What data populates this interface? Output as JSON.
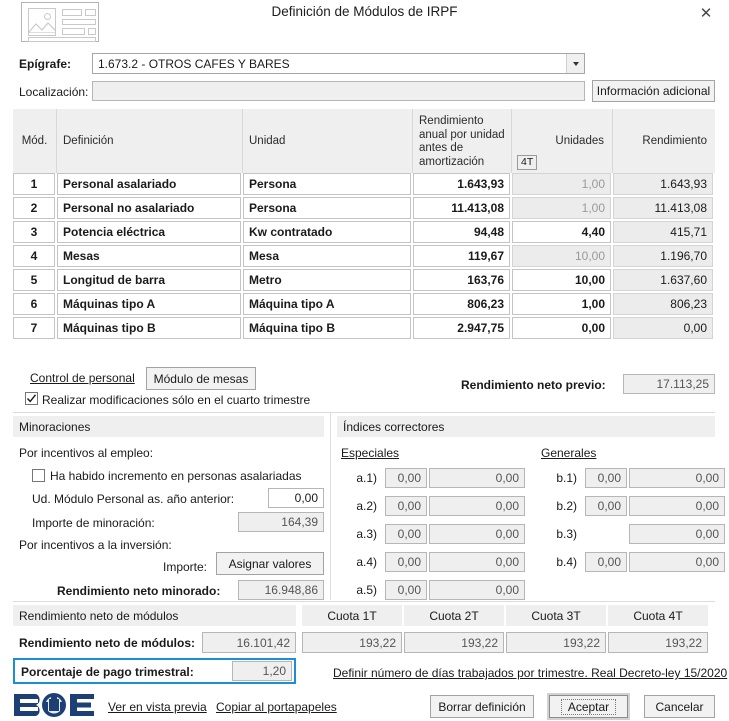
{
  "window": {
    "title": "Definición de Módulos de IRPF",
    "app_icon": "image-placeholder-icon",
    "close_icon": "✕"
  },
  "form": {
    "epigrafe_label": "Epígrafe:",
    "epigrafe_value": "1.673.2 - OTROS CAFES Y BARES",
    "localizacion_label": "Localización:",
    "localizacion_value": "",
    "info_button": "Información adicional"
  },
  "table": {
    "headers": {
      "mod": "Mód.",
      "definicion": "Definición",
      "unidad": "Unidad",
      "rendimiento_unidad": "Rendimiento anual por unidad antes de amortización",
      "unidades": "Unidades",
      "rendimiento": "Rendimiento",
      "quarter_badge": "4T"
    },
    "rows": [
      {
        "mod": "1",
        "definicion": "Personal asalariado",
        "unidad": "Persona",
        "rend_unidad": "1.643,93",
        "unidades": "1,00",
        "unidades_editable": false,
        "rendimiento": "1.643,93"
      },
      {
        "mod": "2",
        "definicion": "Personal no asalariado",
        "unidad": "Persona",
        "rend_unidad": "11.413,08",
        "unidades": "1,00",
        "unidades_editable": false,
        "rendimiento": "11.413,08"
      },
      {
        "mod": "3",
        "definicion": "Potencia eléctrica",
        "unidad": "Kw contratado",
        "rend_unidad": "94,48",
        "unidades": "4,40",
        "unidades_editable": true,
        "rendimiento": "415,71"
      },
      {
        "mod": "4",
        "definicion": "Mesas",
        "unidad": "Mesa",
        "rend_unidad": "119,67",
        "unidades": "10,00",
        "unidades_editable": false,
        "rendimiento": "1.196,70"
      },
      {
        "mod": "5",
        "definicion": "Longitud de barra",
        "unidad": "Metro",
        "rend_unidad": "163,76",
        "unidades": "10,00",
        "unidades_editable": true,
        "rendimiento": "1.637,60"
      },
      {
        "mod": "6",
        "definicion": "Máquinas tipo A",
        "unidad": "Máquina tipo A",
        "rend_unidad": "806,23",
        "unidades": "1,00",
        "unidades_editable": true,
        "rendimiento": "806,23"
      },
      {
        "mod": "7",
        "definicion": "Máquinas tipo B",
        "unidad": "Máquina tipo B",
        "rend_unidad": "2.947,75",
        "unidades": "0,00",
        "unidades_editable": true,
        "rendimiento": "0,00"
      }
    ]
  },
  "controls": {
    "control_personal_link": "Control de personal",
    "modulo_mesas_button": "Módulo de mesas",
    "cuarto_trimestre_check_label": "Realizar modificaciones sólo en el cuarto trimestre",
    "cuarto_trimestre_checked": true,
    "rendimiento_neto_previo_label": "Rendimiento neto previo:",
    "rendimiento_neto_previo_value": "17.113,25"
  },
  "minoraciones": {
    "title": "Minoraciones",
    "incentivos_empleo_label": "Por incentivos al empleo:",
    "incremento_check_label": "Ha habido incremento en personas asalariadas",
    "incremento_checked": false,
    "ud_modulo_label": "Ud. Módulo Personal as. año anterior:",
    "ud_modulo_value": "0,00",
    "importe_minoracion_label": "Importe de minoración:",
    "importe_minoracion_value": "164,39",
    "incentivos_inversion_label": "Por incentivos a la inversión:",
    "importe_label": "Importe:",
    "asignar_valores_button": "Asignar valores",
    "rendimiento_neto_minorado_label": "Rendimiento neto minorado:",
    "rendimiento_neto_minorado_value": "16.948,86"
  },
  "indices": {
    "title": "Índices correctores",
    "especiales_label": "Especiales",
    "generales_label": "Generales",
    "especiales": [
      {
        "key": "a.1)",
        "coef": "0,00",
        "value": "0,00"
      },
      {
        "key": "a.2)",
        "coef": "0,00",
        "value": "0,00"
      },
      {
        "key": "a.3)",
        "coef": "0,00",
        "value": "0,00"
      },
      {
        "key": "a.4)",
        "coef": "0,00",
        "value": "0,00"
      },
      {
        "key": "a.5)",
        "coef": "0,00",
        "value": "0,00"
      }
    ],
    "generales": [
      {
        "key": "b.1)",
        "coef": "0,00",
        "value": "0,00",
        "has_coef": true
      },
      {
        "key": "b.2)",
        "coef": "0,00",
        "value": "0,00",
        "has_coef": true
      },
      {
        "key": "b.3)",
        "coef": "",
        "value": "0,00",
        "has_coef": false
      },
      {
        "key": "b.4)",
        "coef": "0,00",
        "value": "0,00",
        "has_coef": true
      }
    ]
  },
  "bottom": {
    "section_title": "Rendimiento neto de módulos",
    "rendimiento_label": "Rendimiento neto de módulos:",
    "rendimiento_value": "16.101,42",
    "porcentaje_label": "Porcentaje de pago trimestral:",
    "porcentaje_value": "1,20",
    "quota_headers": [
      "Cuota 1T",
      "Cuota 2T",
      "Cuota 3T",
      "Cuota 4T"
    ],
    "quota_values": [
      "193,22",
      "193,22",
      "193,22",
      "193,22"
    ],
    "definir_dias_link": "Definir número de días trabajados por trimestre. Real Decreto-ley 15/2020",
    "highlight_color": "#1a8fd8"
  },
  "footer": {
    "logo": "boe-logo",
    "vista_previa_link": "Ver en vista previa",
    "portapapeles_link": "Copiar al portapapeles",
    "borrar_button": "Borrar definición",
    "aceptar_button": "Aceptar",
    "cancelar_button": "Cancelar"
  }
}
